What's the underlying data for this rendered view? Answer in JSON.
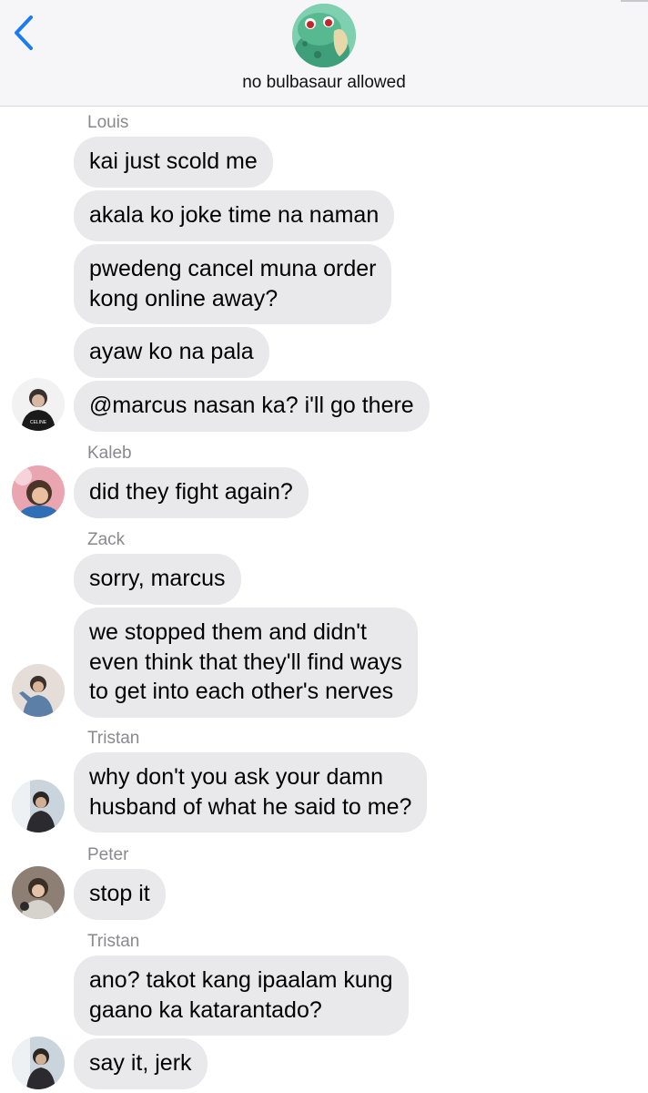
{
  "header": {
    "back_icon": "chevron-left-icon",
    "group_avatar_icon": "bulbasaur-avatar",
    "group_name": "no bulbasaur allowed"
  },
  "messages": [
    {
      "sender": "Louis",
      "text": "kai just scold me"
    },
    {
      "sender": "Louis",
      "text": "akala ko joke time na naman"
    },
    {
      "sender": "Louis",
      "text": "pwedeng cancel muna order\nkong online away?"
    },
    {
      "sender": "Louis",
      "text": "ayaw ko na pala"
    },
    {
      "sender": "Louis",
      "text": "@marcus nasan ka? i'll go there"
    },
    {
      "sender": "Kaleb",
      "text": "did they fight again?"
    },
    {
      "sender": "Zack",
      "text": "sorry, marcus"
    },
    {
      "sender": "Zack",
      "text": "we stopped them and didn't\neven think that they'll find ways\nto get into each other's nerves"
    },
    {
      "sender": "Tristan",
      "text": "why don't you ask your damn\nhusband of what he said to me?"
    },
    {
      "sender": "Peter",
      "text": "stop it"
    },
    {
      "sender": "Tristan",
      "text": "ano? takot kang ipaalam kung\ngaano ka katarantado?"
    },
    {
      "sender": "Tristan",
      "text": "say it, jerk"
    }
  ],
  "avatars": {
    "louis_shirt_text": "CELINE"
  },
  "colors": {
    "accent": "#1a7cf5",
    "bubble": "#e9e9eb",
    "sender_label": "#8a8a8e",
    "header_bg": "#f6f6f8"
  }
}
